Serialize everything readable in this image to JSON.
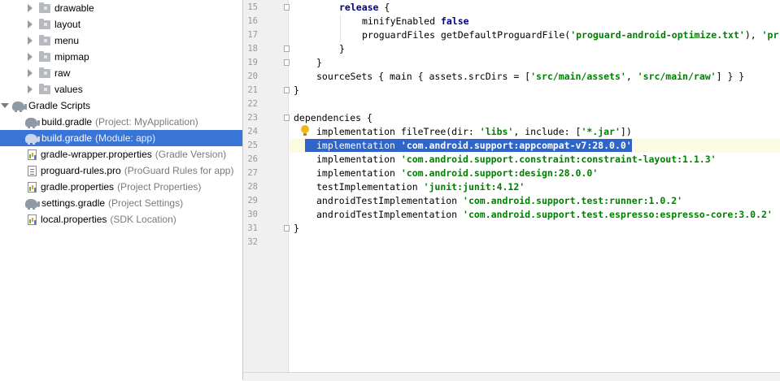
{
  "project_tree": {
    "folders": [
      {
        "label": "drawable"
      },
      {
        "label": "layout"
      },
      {
        "label": "menu"
      },
      {
        "label": "mipmap"
      },
      {
        "label": "raw"
      },
      {
        "label": "values"
      }
    ],
    "gradle_scripts_label": "Gradle Scripts",
    "scripts": [
      {
        "name": "build.gradle",
        "hint": "(Project: MyApplication)",
        "icon": "gradle-elephant-icon"
      },
      {
        "name": "build.gradle",
        "hint": "(Module: app)",
        "icon": "gradle-elephant-icon",
        "selected": true
      },
      {
        "name": "gradle-wrapper.properties",
        "hint": "(Gradle Version)",
        "icon": "properties-file-icon"
      },
      {
        "name": "proguard-rules.pro",
        "hint": "(ProGuard Rules for app)",
        "icon": "text-file-icon"
      },
      {
        "name": "gradle.properties",
        "hint": "(Project Properties)",
        "icon": "properties-file-icon"
      },
      {
        "name": "settings.gradle",
        "hint": "(Project Settings)",
        "icon": "gradle-elephant-icon"
      },
      {
        "name": "local.properties",
        "hint": "(SDK Location)",
        "icon": "properties-file-icon"
      }
    ]
  },
  "editor": {
    "line_numbers": [
      "15",
      "16",
      "17",
      "18",
      "19",
      "20",
      "21",
      "22",
      "23",
      "24",
      "25",
      "26",
      "27",
      "28",
      "29",
      "30",
      "31",
      "32"
    ],
    "lines": {
      "l15": {
        "kw": "release",
        "rest": " {"
      },
      "l16": {
        "plain": "minifyEnabled ",
        "kw": "false"
      },
      "l17": {
        "plain": "proguardFiles getDefaultProguardFile(",
        "str": "'proguard-android-optimize.txt'",
        "tail": "), ",
        "str2": "'pr"
      },
      "l18": {
        "plain": "}"
      },
      "l19": {
        "plain": "}"
      },
      "l20": {
        "plain": "sourceSets { main { assets.srcDirs = [",
        "str": "'src/main/assets'",
        "mid": ", ",
        "str2": "'src/main/raw'",
        "tail": "] } }"
      },
      "l21": {
        "plain": "}"
      },
      "l23": {
        "plain": "dependencies {"
      },
      "l24": {
        "plain": "implementation fileTree(dir: ",
        "str": "'libs'",
        "mid": ", include: [",
        "str2": "'*.jar'",
        "tail": "])"
      },
      "l25": {
        "plain": "implementation ",
        "str": "'com.android.support:appcompat-v7:28.0.0'"
      },
      "l26": {
        "plain": "implementation ",
        "str": "'com.android.support.constraint:constraint-layout:1.1.3'"
      },
      "l27": {
        "plain": "implementation ",
        "str": "'com.android.support:design:28.0.0'"
      },
      "l28": {
        "plain": "testImplementation ",
        "str": "'junit:junit:4.12'"
      },
      "l29": {
        "plain": "androidTestImplementation ",
        "str": "'com.android.support.test:runner:1.0.2'"
      },
      "l30": {
        "plain": "androidTestImplementation ",
        "str": "'com.android.support.test.espresso:espresso-core:3.0.2'"
      },
      "l31": {
        "plain": "}"
      }
    }
  },
  "colors": {
    "selection": "#3875d7",
    "code_selection": "#2f65ca",
    "string": "#008000",
    "keyword": "#000080",
    "current_line": "#fcfae0"
  }
}
